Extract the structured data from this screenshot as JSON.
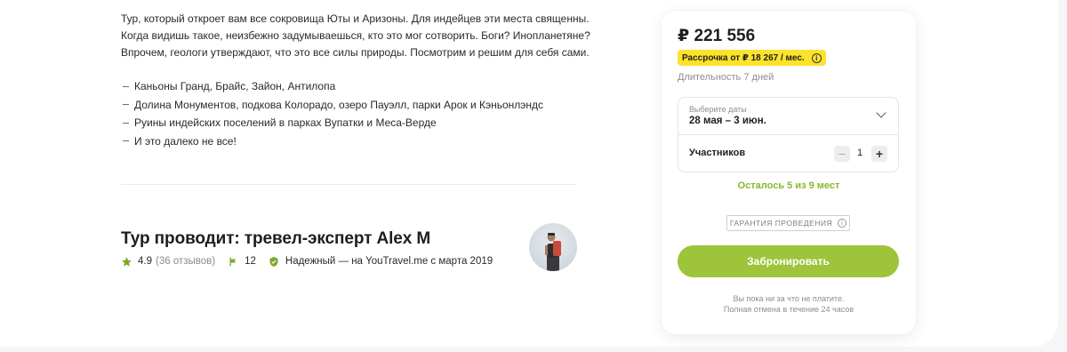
{
  "description": {
    "intro": "Тур, который откроет вам все сокровища Юты и Аризоны. Для индейцев эти места священны. Когда видишь такое, неизбежно задумываешься, кто это мог сотворить. Боги? Инопланетяне? Впрочем, геологи утверждают, что это все силы природы. Посмотрим и решим для себя сами.",
    "features": [
      "Каньоны Гранд, Брайс, Зайон, Антилопа",
      "Долина Монументов, подкова Колорадо, озеро Пауэлл, парки Арок и Кэньонлэндс",
      "Руины индейских поселений в парках Вупатки и Меса-Верде",
      "И это далеко не все!"
    ]
  },
  "guide": {
    "title": "Тур проводит: тревел-эксперт Alex M",
    "rating": "4.9",
    "reviews": "(36 отзывов)",
    "tours_count": "12",
    "reliable": "Надежный — на YouTravel.me с марта 2019"
  },
  "booking": {
    "price": "₽ 221 556",
    "installment": "Рассрочка от ₽ 18 267 / мес.",
    "duration": "Длительность 7 дней",
    "dates_label": "Выберите даты",
    "dates_value": "28 мая – 3 июн.",
    "participants_label": "Участников",
    "participants_value": "1",
    "seats_left": "Осталось 5 из 9 мест",
    "guarantee": "ГАРАНТИЯ ПРОВЕДЕНИЯ",
    "book_button": "Забронировать",
    "note_line1": "Вы пока ни за что не платите.",
    "note_line2": "Полная отмена в течение 24 часов"
  },
  "colors": {
    "accent_green": "#9dc43b",
    "seats_green": "#86b82b",
    "installment_yellow": "#fde22b",
    "icon_green": "#7aa82a"
  }
}
